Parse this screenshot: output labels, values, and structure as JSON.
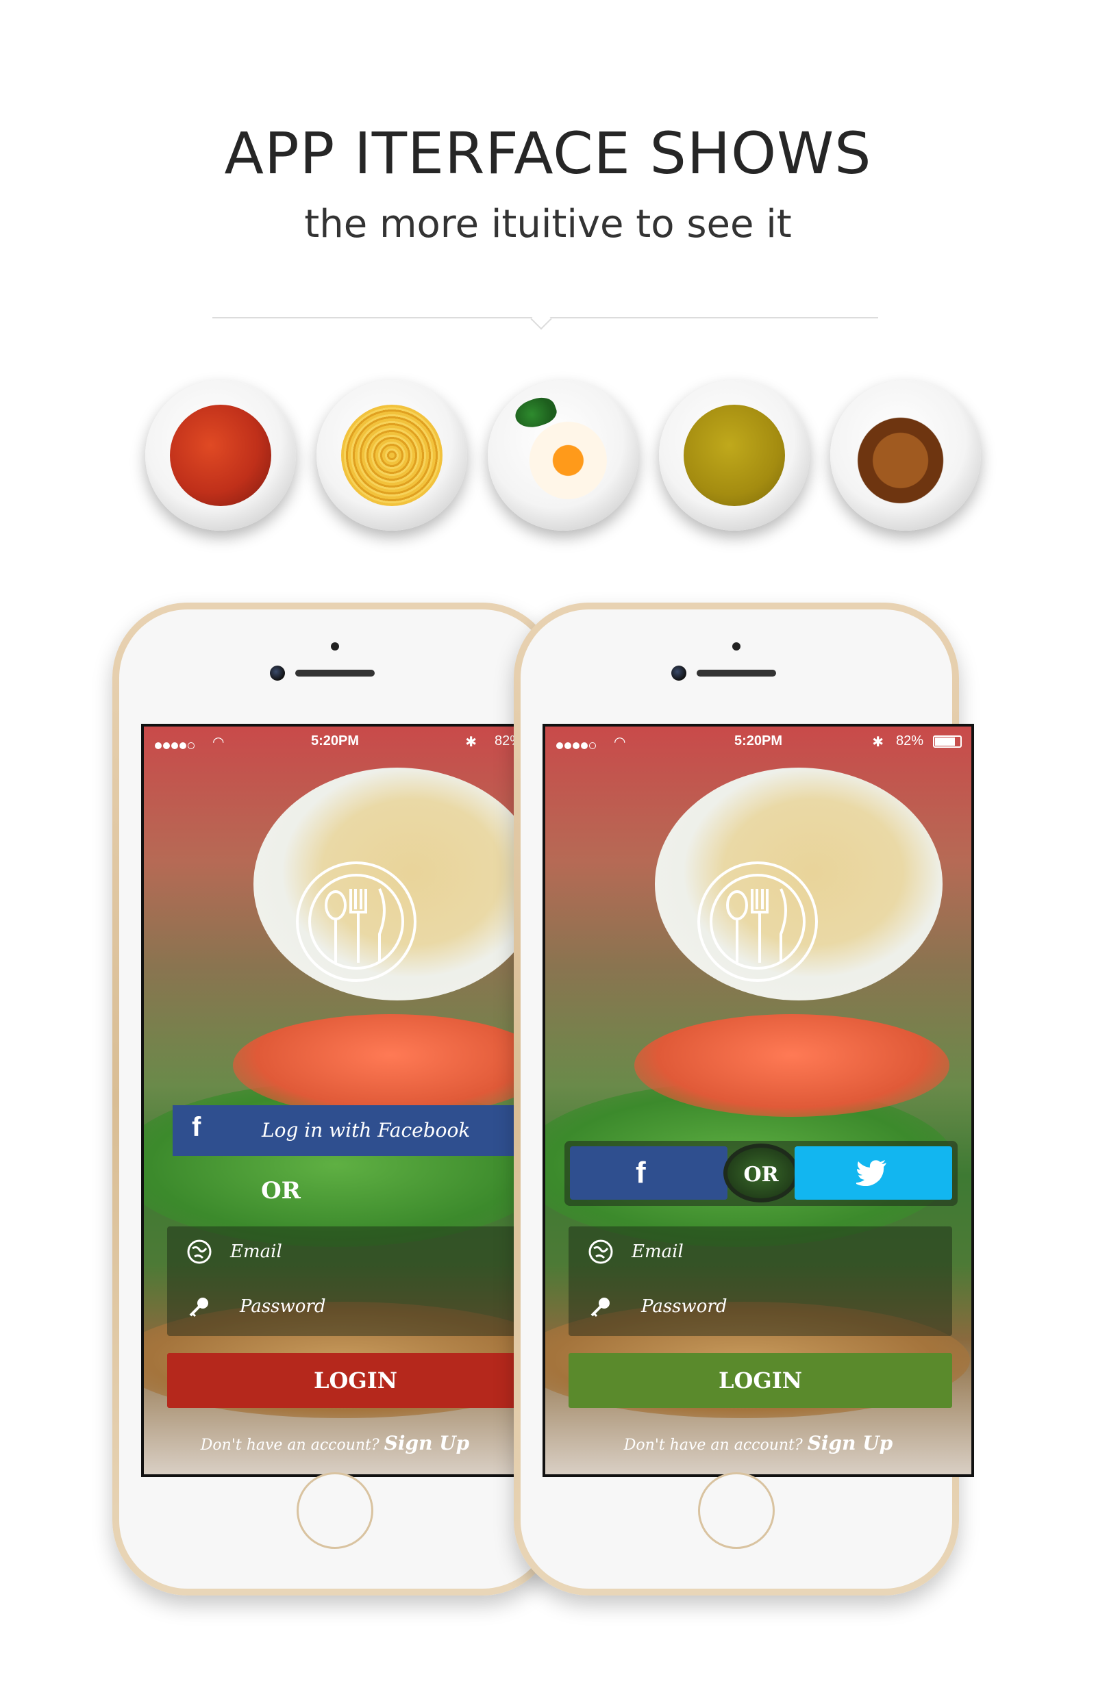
{
  "hero": {
    "title": "APP ITERFACE SHOWS",
    "subtitle": "the more ituitive to see it"
  },
  "plates": [
    {
      "dish": "tomato-soup"
    },
    {
      "dish": "spaghetti"
    },
    {
      "dish": "fried-egg"
    },
    {
      "dish": "green-curry"
    },
    {
      "dish": "croissant"
    }
  ],
  "phones": [
    {
      "status": {
        "time": "5:20PM",
        "battery": "82%",
        "battery_level": 0.82
      },
      "facebook_label": "Log in with Facebook",
      "facebook_letter": "f",
      "or_label": "OR",
      "email_label": "Email",
      "password_label": "Password",
      "login_label": "LOGIN",
      "login_color": "#b5281c",
      "signup_prompt": "Don't have an account?",
      "signup_link": "Sign Up"
    },
    {
      "status": {
        "time": "5:20PM",
        "battery": "82%",
        "battery_level": 0.82
      },
      "facebook_letter": "f",
      "or_label": "OR",
      "twitter_color": "#12b6f0",
      "email_label": "Email",
      "password_label": "Password",
      "login_label": "LOGIN",
      "login_color": "#5a8a2c",
      "signup_prompt": "Don't have an account?",
      "signup_link": "Sign Up"
    }
  ],
  "colors": {
    "facebook": "#2f4f8f",
    "twitter": "#12b6f0",
    "login_red": "#b5281c",
    "login_green": "#5a8a2c",
    "phone_gold": "#d9bd94"
  }
}
